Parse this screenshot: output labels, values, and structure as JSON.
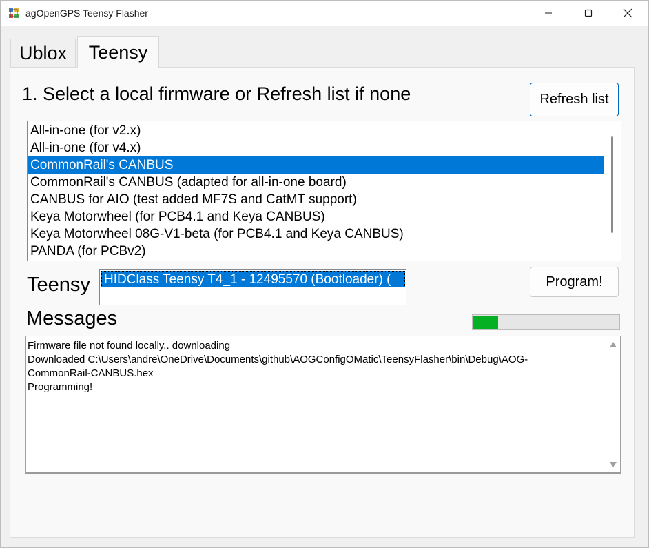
{
  "window": {
    "title": "agOpenGPS Teensy Flasher"
  },
  "tabs": [
    {
      "label": "Ublox",
      "active": false
    },
    {
      "label": "Teensy",
      "active": true
    }
  ],
  "main": {
    "heading": "1. Select a local firmware or Refresh list if none",
    "refresh_label": "Refresh list",
    "firmware_list": [
      "All-in-one (for v2.x)",
      "All-in-one (for v4.x)",
      "CommonRail's CANBUS",
      "CommonRail's CANBUS (adapted for all-in-one board)",
      "CANBUS for AIO (test added MF7S and CatMT support)",
      "Keya Motorwheel (for PCB4.1 and Keya CANBUS)",
      "Keya Motorwheel 08G-V1-beta (for PCB4.1 and Keya CANBUS)",
      "PANDA (for PCBv2)"
    ],
    "selected_firmware": "CommonRail's CANBUS",
    "teensy_label": "Teensy",
    "devices": [
      "HIDClass Teensy T4_1 - 12495570 (Bootloader) ("
    ],
    "program_label": "Program!",
    "messages_label": "Messages",
    "progress_fraction": 0.17,
    "messages_text": "Firmware file not found locally.. downloading\nDownloaded C:\\Users\\andre\\OneDrive\\Documents\\github\\AOGConfigOMatic\\TeensyFlasher\\bin\\Debug\\AOG-\nCommonRail-CANBUS.hex\nProgramming!"
  },
  "colors": {
    "selection": "#0078d7",
    "progress": "#06b025",
    "focus_border": "#0067c0"
  }
}
